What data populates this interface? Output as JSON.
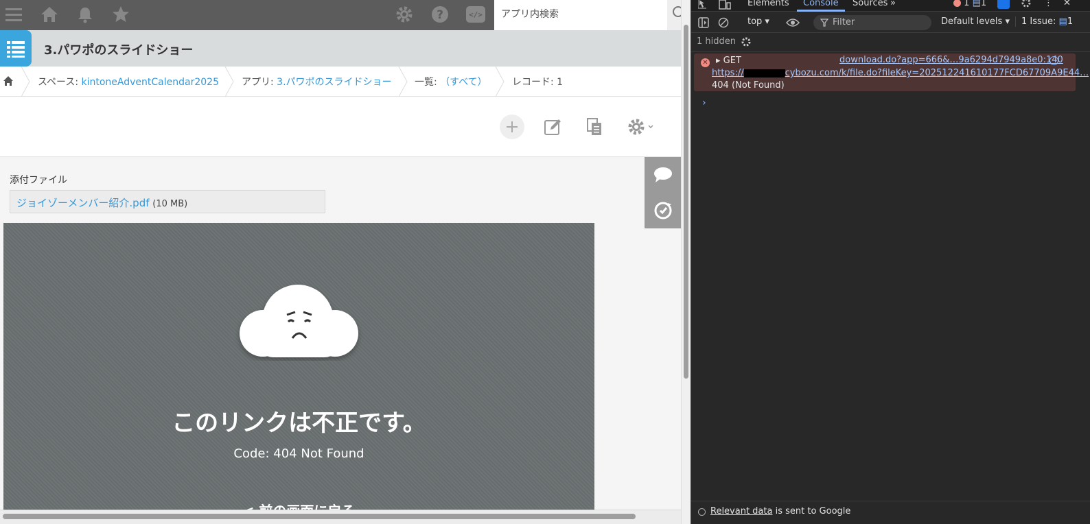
{
  "app": {
    "search_placeholder": "アプリ内検索",
    "title": "3.パワポのスライドショー",
    "breadcrumb": {
      "space_prefix": "スペース: ",
      "space_name": "kintoneAdventCalendar2025",
      "app_prefix": "アプリ: ",
      "app_name": "3.パワポのスライドショー",
      "view_prefix": "一覧: ",
      "view_name": "（すべて）",
      "record": "レコード: 1"
    },
    "field": {
      "label": "添付ファイル",
      "file_name": "ジョイゾーメンバー紹介.pdf",
      "file_size": "(10 MB)"
    },
    "preview": {
      "message": "このリンクは不正です。",
      "code": "Code: 404 Not Found",
      "back": "< 前の画面に戻る"
    },
    "colors": {
      "accent": "#3498db",
      "header": "#5c5c5c",
      "app_icon": "#3aa6dd"
    }
  },
  "devtools": {
    "tabs": [
      "Elements",
      "Console",
      "Sources"
    ],
    "active_tab": "Console",
    "more": "»",
    "error_count": "1",
    "message_count": "1",
    "toolbar": {
      "context": "top ▾",
      "filter_placeholder": "Filter",
      "levels": "Default levels ▾",
      "issues": "1 Issue:",
      "issues_count": "1"
    },
    "hidden": "1 hidden",
    "error": {
      "method": "▸ GET",
      "source": "download.do?app=666&…9a6294d7949a8e0:140",
      "url_start": "https://",
      "url_rest": "cybozu.com/k/file.do?fileKey=202512241610177FCD67709A9E44…",
      "status": "404 (Not Found)"
    },
    "prompt": "›",
    "footer": {
      "link": "Relevant data",
      "text": " is sent to Google"
    }
  }
}
